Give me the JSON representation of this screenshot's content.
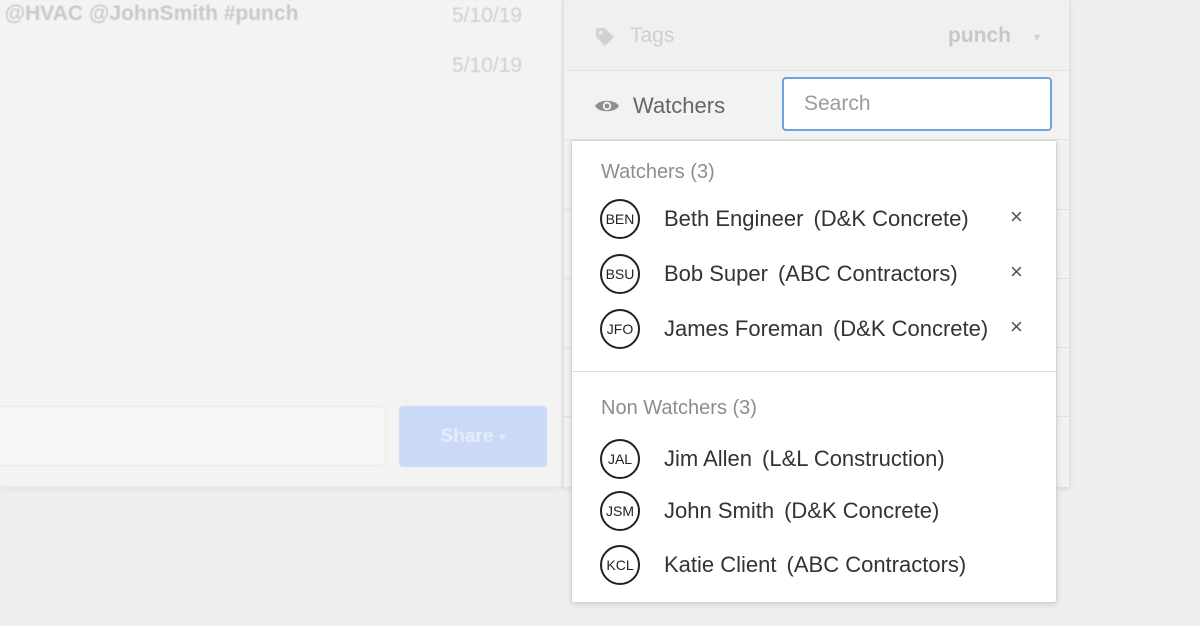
{
  "background": {
    "comment_text": "g @HVAC @JohnSmith #punch",
    "dates": [
      "5/10/19",
      "5/10/19"
    ],
    "share_label": "Share",
    "share_caret": "▾"
  },
  "side_panel": {
    "tags": {
      "label": "Tags",
      "value": "punch",
      "caret": "▾",
      "icon": "tag-icon"
    },
    "watchers": {
      "label": "Watchers",
      "icon": "eye-icon",
      "search_placeholder": "Search",
      "search_value": ""
    }
  },
  "dropdown": {
    "watchers_title": "Watchers (3)",
    "watchers": [
      {
        "initials": "BEN",
        "name": "Beth Engineer",
        "company": "(D&K Concrete)",
        "remove": "×"
      },
      {
        "initials": "BSU",
        "name": "Bob Super",
        "company": "(ABC Contractors)",
        "remove": "×"
      },
      {
        "initials": "JFO",
        "name": "James Foreman",
        "company": "(D&K Concrete)",
        "remove": "×"
      }
    ],
    "non_watchers_title": "Non Watchers (3)",
    "non_watchers": [
      {
        "initials": "JAL",
        "name": "Jim Allen",
        "company": "(L&L Construction)"
      },
      {
        "initials": "JSM",
        "name": "John Smith",
        "company": "(D&K Concrete)"
      },
      {
        "initials": "KCL",
        "name": "Katie Client",
        "company": "(ABC Contractors)"
      }
    ]
  },
  "colors": {
    "accent_border": "#6fa3df",
    "share_button": "#c9d9f6",
    "avatar_border": "#222222"
  }
}
